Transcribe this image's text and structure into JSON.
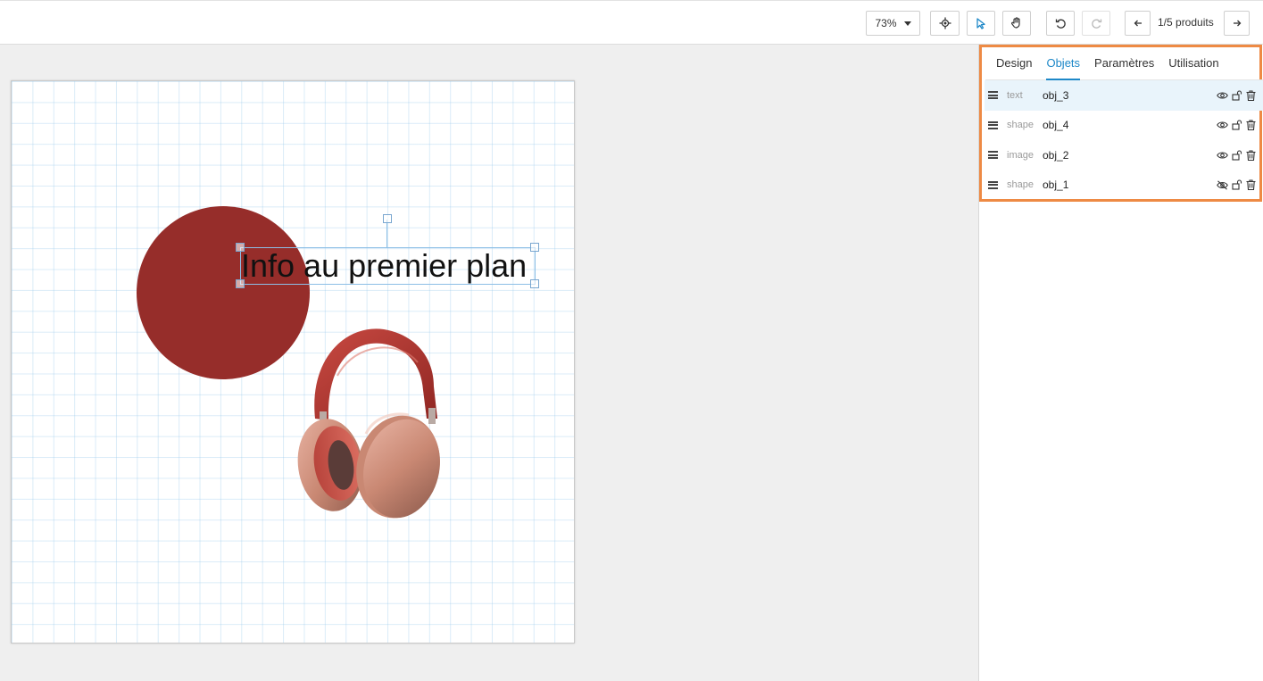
{
  "toolbar": {
    "zoom": "73%",
    "products_label": "1/5 produits",
    "icons": [
      "target-icon",
      "pointer-icon",
      "hand-icon",
      "undo-icon",
      "redo-icon",
      "arrow-left-icon",
      "arrow-right-icon"
    ]
  },
  "canvas": {
    "text_object": "Info au premier plan",
    "circle_color": "#962d2a"
  },
  "panel": {
    "tabs": [
      {
        "label": "Design"
      },
      {
        "label": "Objets"
      },
      {
        "label": "Paramètres"
      },
      {
        "label": "Utilisation"
      }
    ],
    "active_tab": "Objets",
    "objects": [
      {
        "type": "text",
        "name": "obj_3",
        "visible": true,
        "selected": true
      },
      {
        "type": "shape",
        "name": "obj_4",
        "visible": true,
        "selected": false
      },
      {
        "type": "image",
        "name": "obj_2",
        "visible": true,
        "selected": false
      },
      {
        "type": "shape",
        "name": "obj_1",
        "visible": false,
        "selected": false
      }
    ],
    "frame_color": "#ee8a44",
    "accent_color": "#1e88c8"
  }
}
